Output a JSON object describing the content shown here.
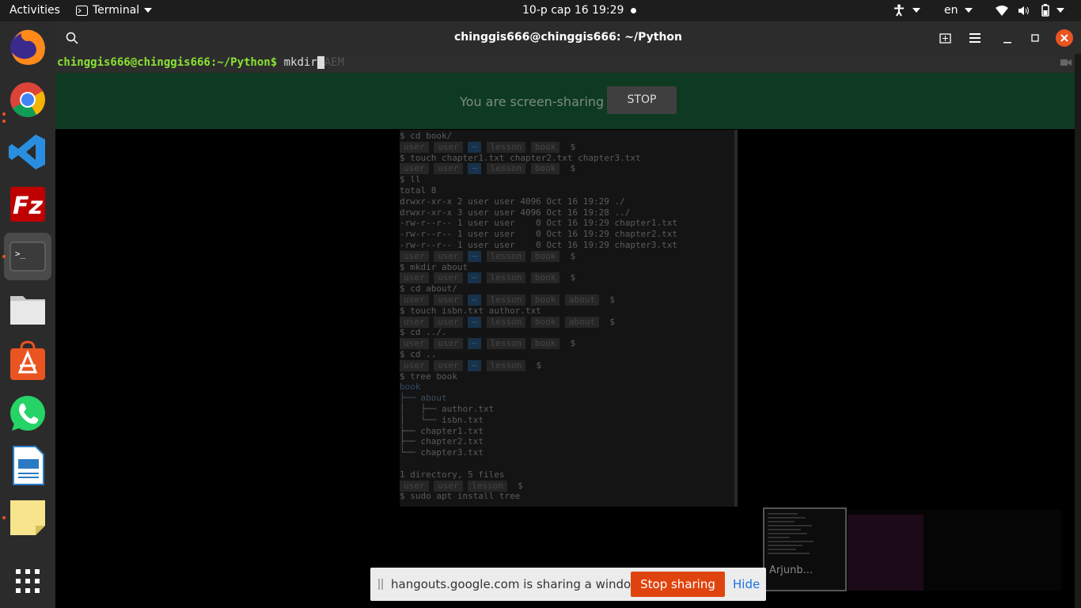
{
  "topbar": {
    "activities": "Activities",
    "app_menu": "Terminal",
    "clock": "10-р сар 16  19:29",
    "language": "en"
  },
  "dock": {
    "apps": [
      "firefox-icon",
      "chrome-icon",
      "vscode-icon",
      "filezilla-icon",
      "terminal-icon",
      "files-icon",
      "software-icon",
      "whatsapp-icon",
      "writer-icon",
      "notes-icon",
      "app-grid-icon"
    ]
  },
  "terminal": {
    "title": "chinggis666@chinggis666: ~/Python",
    "prompt": "chinggis666@chinggis666:~/Python$",
    "command": "mkdir",
    "hidden_fragment": "AEM"
  },
  "share_banner": {
    "text": "You are screen-sharing",
    "stop_label": "STOP"
  },
  "shared_terminal": {
    "lines": [
      {
        "type": "cmd",
        "text": "$ cd book/"
      },
      {
        "type": "prompt",
        "segs": [
          "user",
          "user",
          "~",
          "lesson",
          "book"
        ],
        "end": "$"
      },
      {
        "type": "cmd",
        "text": "$ touch chapter1.txt chapter2.txt chapter3.txt"
      },
      {
        "type": "prompt",
        "segs": [
          "user",
          "user",
          "~",
          "lesson",
          "book"
        ],
        "end": "$"
      },
      {
        "type": "cmd",
        "text": "$ ll"
      },
      {
        "type": "out",
        "text": "total 8"
      },
      {
        "type": "out",
        "text": "drwxr-xr-x 2 user user 4096 Oct 16 19:29 ./"
      },
      {
        "type": "out",
        "text": "drwxr-xr-x 3 user user 4096 Oct 16 19:28 ../"
      },
      {
        "type": "out",
        "text": "-rw-r--r-- 1 user user    0 Oct 16 19:29 chapter1.txt"
      },
      {
        "type": "out",
        "text": "-rw-r--r-- 1 user user    0 Oct 16 19:29 chapter2.txt"
      },
      {
        "type": "out",
        "text": "-rw-r--r-- 1 user user    0 Oct 16 19:29 chapter3.txt"
      },
      {
        "type": "prompt",
        "segs": [
          "user",
          "user",
          "~",
          "lesson",
          "book"
        ],
        "end": "$"
      },
      {
        "type": "cmd",
        "text": "$ mkdir about"
      },
      {
        "type": "prompt",
        "segs": [
          "user",
          "user",
          "~",
          "lesson",
          "book"
        ],
        "end": "$"
      },
      {
        "type": "cmd",
        "text": "$ cd about/"
      },
      {
        "type": "prompt",
        "segs": [
          "user",
          "user",
          "~",
          "lesson",
          "book",
          "about"
        ],
        "end": "$"
      },
      {
        "type": "cmd",
        "text": "$ touch isbn.txt author.txt"
      },
      {
        "type": "prompt",
        "segs": [
          "user",
          "user",
          "~",
          "lesson",
          "book",
          "about"
        ],
        "end": "$"
      },
      {
        "type": "cmd",
        "text": "$ cd ../."
      },
      {
        "type": "prompt",
        "segs": [
          "user",
          "user",
          "~",
          "lesson",
          "book"
        ],
        "end": "$"
      },
      {
        "type": "cmd",
        "text": "$ cd .."
      },
      {
        "type": "prompt",
        "segs": [
          "user",
          "user",
          "~",
          "lesson"
        ],
        "end": "$"
      },
      {
        "type": "cmd",
        "text": "$ tree book"
      },
      {
        "type": "dir",
        "text": "book"
      },
      {
        "type": "tree",
        "text": "├── about",
        "dirpart": true
      },
      {
        "type": "out",
        "text": "│   ├── author.txt"
      },
      {
        "type": "out",
        "text": "│   └── isbn.txt"
      },
      {
        "type": "out",
        "text": "├── chapter1.txt"
      },
      {
        "type": "out",
        "text": "├── chapter2.txt"
      },
      {
        "type": "out",
        "text": "└── chapter3.txt"
      },
      {
        "type": "out",
        "text": ""
      },
      {
        "type": "out",
        "text": "1 directory, 5 files"
      },
      {
        "type": "prompt",
        "segs": [
          "user",
          "user",
          "lesson"
        ],
        "end": "$"
      },
      {
        "type": "cmd",
        "text": "$ sudo apt install tree"
      }
    ]
  },
  "thumbnail": {
    "label": "Arjunb..."
  },
  "notification": {
    "text": "hangouts.google.com is sharing a window.",
    "stop_label": "Stop sharing",
    "hide_label": "Hide"
  }
}
